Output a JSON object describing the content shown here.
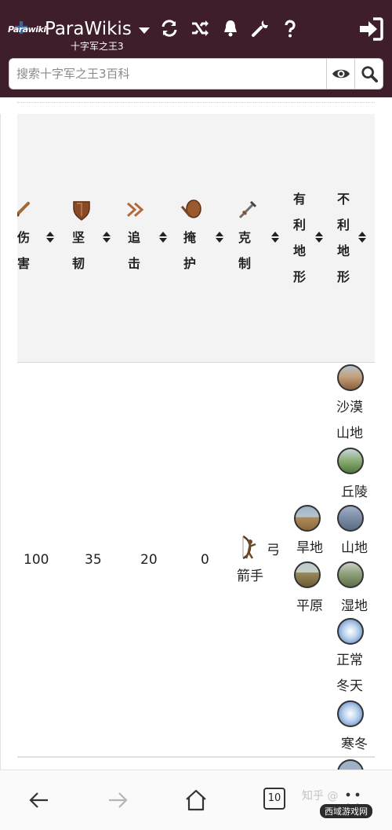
{
  "header": {
    "logo_text": "Parawiki",
    "title": "ParaWikis",
    "subtitle": "十字军之王3",
    "icons": [
      "refresh-icon",
      "shuffle-icon",
      "bell-icon",
      "wrench-icon",
      "help-icon",
      "login-icon"
    ]
  },
  "search": {
    "placeholder": "搜索十字军之王3百科"
  },
  "table": {
    "columns": [
      {
        "label": "伤害",
        "icon": "sword-icon",
        "partial": true
      },
      {
        "label": "坚韧",
        "icon": "shield-icon"
      },
      {
        "label": "追击",
        "icon": "pursuit-icon"
      },
      {
        "label": "掩护",
        "icon": "screen-icon"
      },
      {
        "label": "克制",
        "icon": "counter-icon"
      },
      {
        "label": "有利地形"
      },
      {
        "label": "不利地形"
      }
    ],
    "row": {
      "damage": "100",
      "toughness": "35",
      "pursuit": "20",
      "screen": "0",
      "counter": "弓箭手",
      "favorable_terrain": [
        "旱地",
        "平原"
      ],
      "unfavorable_terrain": [
        "沙漠山地",
        "丘陵",
        "山地",
        "湿地",
        "正常冬天",
        "寒冬"
      ]
    }
  },
  "bottom_nav": {
    "tab_count": "10",
    "watermark": "西域游戏网",
    "watermark_faded": "知乎 @"
  },
  "colors": {
    "header_bg": "#3d1e2a",
    "table_header_bg": "#f3f3f3"
  }
}
